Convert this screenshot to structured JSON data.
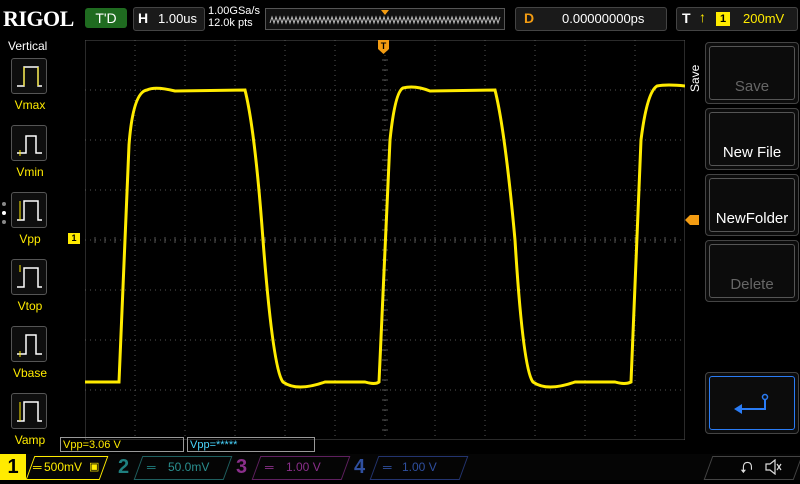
{
  "brand": "RIGOL",
  "run_status": "T'D",
  "horizontal": {
    "key": "H",
    "timebase": "1.00us"
  },
  "acquisition": {
    "sample_rate": "1.00GSa/s",
    "memory_depth": "12.0k pts"
  },
  "delay": {
    "key": "D",
    "value": "0.00000000ps"
  },
  "trigger": {
    "key": "T",
    "edge_icon": "rising-edge",
    "source": "1",
    "level": "200mV"
  },
  "left_panel": {
    "title": "Vertical",
    "items": [
      {
        "label": "Vmax"
      },
      {
        "label": "Vmin"
      },
      {
        "label": "Vpp"
      },
      {
        "label": "Vtop"
      },
      {
        "label": "Vbase"
      },
      {
        "label": "Vamp"
      }
    ]
  },
  "menu": {
    "title": "Save",
    "items": [
      {
        "label": "Save",
        "enabled": false
      },
      {
        "label": "New File",
        "enabled": true
      },
      {
        "label": "NewFolder",
        "enabled": true
      },
      {
        "label": "Delete",
        "enabled": false
      },
      {
        "label": "Return",
        "icon": "return-arrow-icon",
        "enabled": true
      }
    ]
  },
  "markers": {
    "ch1": "1",
    "trigger_pos": "T"
  },
  "measurements": [
    {
      "text": "Vpp=3.06 V",
      "color": "#ffeb00"
    },
    {
      "text": "Vpp=*****",
      "color": "#4ad6ff"
    }
  ],
  "channels": [
    {
      "num": "1",
      "scale": "500mV",
      "color": "#ffeb00",
      "active": true
    },
    {
      "num": "2",
      "scale": "50.0mV",
      "color": "#00c8c8",
      "active": false
    },
    {
      "num": "3",
      "scale": "1.00 V",
      "color": "#d040d0",
      "active": false
    },
    {
      "num": "4",
      "scale": "1.00 V",
      "color": "#3a6bd8",
      "active": false
    }
  ],
  "status_icons": [
    "usb-icon",
    "speaker-muted-icon"
  ],
  "colors": {
    "trace": "#ffeb00",
    "accent": "#f39c12",
    "grid": "#555555"
  }
}
